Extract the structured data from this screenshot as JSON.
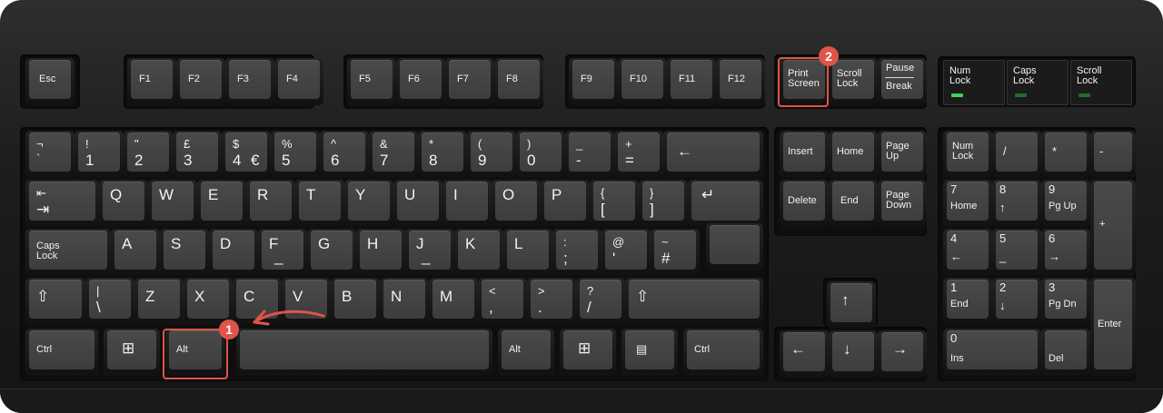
{
  "keyboard": {
    "function_row": {
      "esc": "Esc",
      "f1": "F1",
      "f2": "F2",
      "f3": "F3",
      "f4": "F4",
      "f5": "F5",
      "f6": "F6",
      "f7": "F7",
      "f8": "F8",
      "f9": "F9",
      "f10": "F10",
      "f11": "F11",
      "f12": "F12",
      "print_screen": "Print\nScreen",
      "scroll_lock": "Scroll\nLock",
      "pause_top": "Pause",
      "pause_bottom": "Break"
    },
    "indicators": {
      "num_lock": "Num\nLock",
      "caps_lock": "Caps\nLock",
      "scroll_lock": "Scroll\nLock",
      "led_on_color": "#3fd45a",
      "led_off_color": "#1f6e2c"
    },
    "number_row": [
      {
        "top": "¬",
        "bottom": "`"
      },
      {
        "top": "!",
        "bottom": "1"
      },
      {
        "top": "\"",
        "bottom": "2"
      },
      {
        "top": "£",
        "bottom": "3"
      },
      {
        "top": "$",
        "bottom": "4",
        "extra": "€"
      },
      {
        "top": "%",
        "bottom": "5"
      },
      {
        "top": "^",
        "bottom": "6"
      },
      {
        "top": "&",
        "bottom": "7"
      },
      {
        "top": "*",
        "bottom": "8"
      },
      {
        "top": "(",
        "bottom": "9"
      },
      {
        "top": ")",
        "bottom": "0"
      },
      {
        "top": "_",
        "bottom": "-"
      },
      {
        "top": "+",
        "bottom": "="
      },
      {
        "label": "←"
      }
    ],
    "qwerty_row": [
      {
        "top": "⇤",
        "bottom": "⇥"
      },
      {
        "label": "Q"
      },
      {
        "label": "W"
      },
      {
        "label": "E"
      },
      {
        "label": "R"
      },
      {
        "label": "T"
      },
      {
        "label": "Y"
      },
      {
        "label": "U"
      },
      {
        "label": "I"
      },
      {
        "label": "O"
      },
      {
        "label": "P"
      },
      {
        "top": "{",
        "bottom": "["
      },
      {
        "top": "}",
        "bottom": "]"
      },
      {
        "label": "↵"
      }
    ],
    "home_row": [
      {
        "label": "Caps\nLock"
      },
      {
        "label": "A"
      },
      {
        "label": "S"
      },
      {
        "label": "D"
      },
      {
        "label": "F",
        "extra": "_"
      },
      {
        "label": "G"
      },
      {
        "label": "H"
      },
      {
        "label": "J",
        "extra": "_"
      },
      {
        "label": "K"
      },
      {
        "label": "L"
      },
      {
        "top": ":",
        "bottom": ";"
      },
      {
        "top": "@",
        "bottom": "'"
      },
      {
        "top": "~",
        "bottom": "#"
      }
    ],
    "shift_row": [
      {
        "label": "⇧"
      },
      {
        "top": "|",
        "bottom": "\\"
      },
      {
        "label": "Z"
      },
      {
        "label": "X"
      },
      {
        "label": "C"
      },
      {
        "label": "V"
      },
      {
        "label": "B"
      },
      {
        "label": "N"
      },
      {
        "label": "M"
      },
      {
        "top": "<",
        "bottom": ","
      },
      {
        "top": ">",
        "bottom": "."
      },
      {
        "top": "?",
        "bottom": "/"
      },
      {
        "label": "⇧"
      }
    ],
    "bottom_row": {
      "ctrl_left": "Ctrl",
      "win_left": "⊞",
      "alt_left": "Alt",
      "space": "",
      "alt_right": "Alt",
      "win_right": "⊞",
      "menu": "▤",
      "ctrl_right": "Ctrl"
    },
    "nav_cluster": {
      "insert": "Insert",
      "home": "Home",
      "page_up": "Page\nUp",
      "delete": "Delete",
      "end": "End",
      "page_down": "Page\nDown",
      "up": "↑",
      "left": "←",
      "down": "↓",
      "right": "→"
    },
    "numpad": {
      "num_lock": "Num\nLock",
      "divide": "/",
      "multiply": "*",
      "minus": "-",
      "plus": "+",
      "enter": "Enter",
      "n7": "7",
      "n7_sub": "Home",
      "n8": "8",
      "n8_sub": "↑",
      "n9": "9",
      "n9_sub": "Pg Up",
      "n4": "4",
      "n4_sub": "←",
      "n5": "5",
      "n5_sub": "_",
      "n6": "6",
      "n6_sub": "→",
      "n1": "1",
      "n1_sub": "End",
      "n2": "2",
      "n2_sub": "↓",
      "n3": "3",
      "n3_sub": "Pg Dn",
      "n0": "0",
      "n0_sub": "Ins",
      "decimal_sub": "Del"
    },
    "annotations": {
      "step_1": "1",
      "step_2": "2",
      "highlight_color": "#e0544a"
    }
  }
}
